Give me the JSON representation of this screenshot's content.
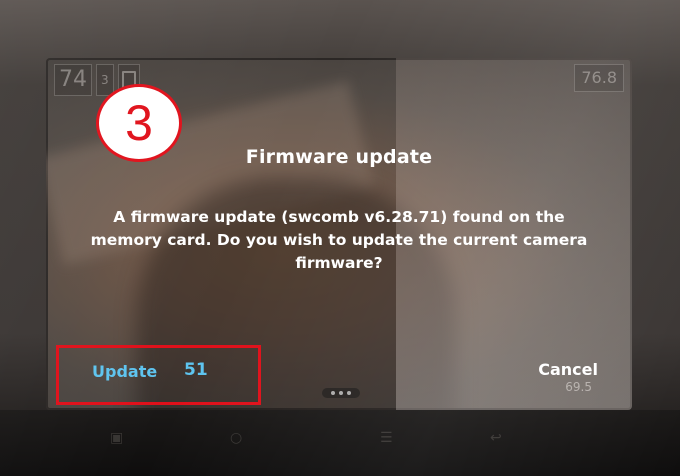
{
  "status_bar": {
    "left_value": "74",
    "left_small": "3",
    "right_value": "76.8",
    "battery_icon": "battery-icon"
  },
  "dialog": {
    "title": "Firmware update",
    "message": "A firmware update (swcomb v6.28.71) found on the memory card. Do you wish to update the current camera firmware?",
    "update_label": "Update",
    "update_count": "51",
    "cancel_label": "Cancel",
    "bottom_right_value": "69.5"
  },
  "annotation": {
    "step_number": "3",
    "color": "#e0101a"
  },
  "colors": {
    "accent": "#5ec4ef",
    "dialog_text": "#ffffff"
  }
}
